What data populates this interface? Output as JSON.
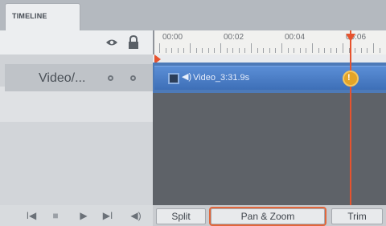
{
  "tabs": [
    {
      "label": "TIMELINE"
    }
  ],
  "ruler": {
    "labels": [
      "00:00",
      "00:02",
      "00:04",
      "00:06"
    ]
  },
  "track": {
    "name": "Video/..."
  },
  "clip": {
    "name": "Video_3:31.9s",
    "audio_icon": "speaker-icon"
  },
  "playhead": {
    "knob_label": "!"
  },
  "transport": {
    "buttons": [
      {
        "name": "go-to-start-icon",
        "glyph": "I◀"
      },
      {
        "name": "stop-icon",
        "glyph": "■"
      },
      {
        "name": "play-icon",
        "glyph": "▶"
      },
      {
        "name": "go-to-end-icon",
        "glyph": "▶I"
      },
      {
        "name": "volume-icon",
        "glyph": "◀)"
      }
    ]
  },
  "actions": {
    "split": "Split",
    "pan_zoom": "Pan & Zoom",
    "trim": "Trim"
  },
  "colors": {
    "clip": "#4d7ab8",
    "playhead": "#e6532e",
    "highlight": "#e2673c"
  }
}
